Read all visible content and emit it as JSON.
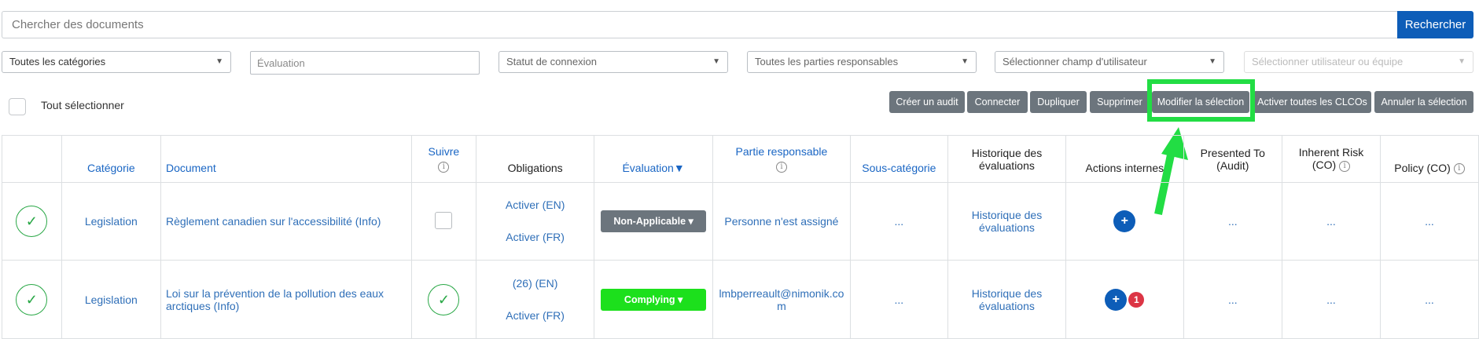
{
  "search": {
    "placeholder": "Chercher des documents",
    "button_label": "Rechercher"
  },
  "filters": {
    "categories": "Toutes les catégories",
    "evaluation_placeholder": "Évaluation",
    "connection_status": "Statut de connexion",
    "responsible_parties": "Toutes les parties responsables",
    "user_field": "Sélectionner champ d'utilisateur",
    "user_or_team": "Sélectionner utilisateur ou équipe"
  },
  "select_all_label": "Tout sélectionner",
  "actions": {
    "create_audit": "Créer un audit",
    "connect": "Connecter",
    "duplicate": "Dupliquer",
    "delete": "Supprimer",
    "modify_selection": "Modifier la sélection",
    "activate_all_clcos": "Activer toutes les CLCOs",
    "cancel_selection": "Annuler la sélection"
  },
  "table": {
    "headers": {
      "category": "Catégorie",
      "document": "Document",
      "follow": "Suivre",
      "obligations": "Obligations",
      "evaluation": "Évaluation▼",
      "responsible_party": "Partie responsable",
      "subcategory": "Sous-catégorie",
      "evaluation_history": "Historique des évaluations",
      "internal_actions": "Actions internes",
      "presented_to": "Presented To (Audit)",
      "inherent_risk": "Inherent Risk (CO)",
      "policy": "Policy (CO)"
    },
    "rows": [
      {
        "category": "Legislation",
        "document": "Règlement canadien sur l'accessibilité (Info)",
        "obligation_1": "Activer (EN)",
        "obligation_2": "Activer (FR)",
        "evaluation": "Non-Applicable ▾",
        "responsible": "Personne n'est assigné",
        "subcategory": "...",
        "history": "Historique des évaluations",
        "presented_to": "...",
        "inherent_risk": "...",
        "policy": "..."
      },
      {
        "category": "Legislation",
        "document": "Loi sur la prévention de la pollution des eaux arctiques (Info)",
        "obligation_1": "(26) (EN)",
        "obligation_2": "Activer (FR)",
        "evaluation": "Complying ▾",
        "responsible": "lmbperreault@nimonik.com",
        "subcategory": "...",
        "history": "Historique des évaluations",
        "actions_badge": "1",
        "presented_to": "...",
        "inherent_risk": "...",
        "policy": "..."
      }
    ]
  },
  "icons": {
    "info": "i",
    "check": "✓",
    "plus": "+",
    "caret": "▾"
  },
  "colors": {
    "primary": "#0d5db8",
    "highlight": "#22dd44",
    "success": "#28a745",
    "complying": "#1ce01c"
  }
}
